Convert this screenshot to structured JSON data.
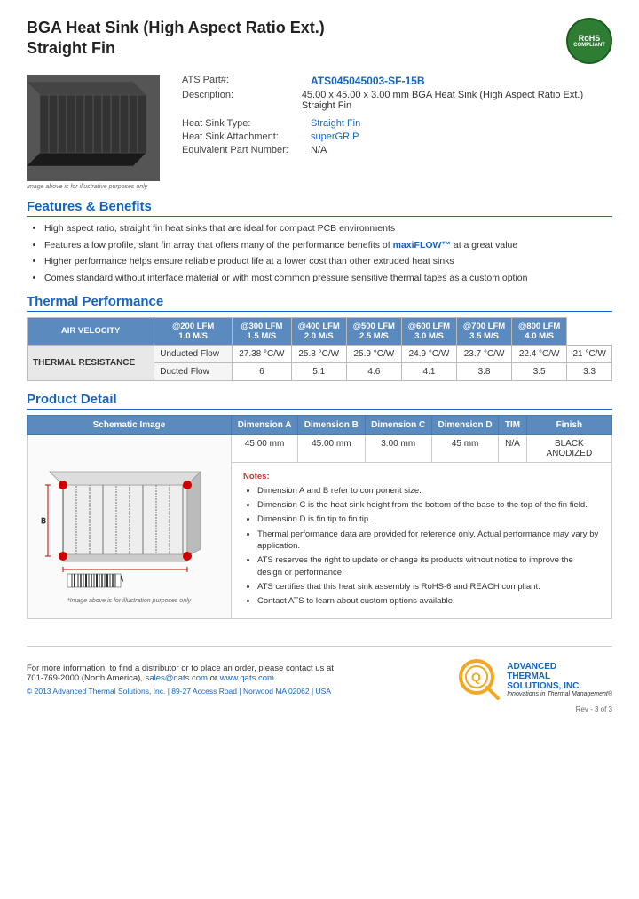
{
  "product": {
    "title_line1": "BGA Heat Sink (High Aspect Ratio Ext.)",
    "title_line2": "Straight Fin",
    "part_number": "ATS045045003-SF-15B",
    "description": "45.00 x 45.00 x 3.00 mm  BGA Heat Sink (High Aspect Ratio Ext.) Straight Fin",
    "heat_sink_type": "Straight Fin",
    "heat_sink_attachment": "superGRIP",
    "equivalent_part": "N/A"
  },
  "labels": {
    "part_number_label": "ATS Part#:",
    "description_label": "Description:",
    "heat_sink_type_label": "Heat Sink Type:",
    "attachment_label": "Heat Sink Attachment:",
    "equivalent_label": "Equivalent Part Number:",
    "image_caption": "Image above is for illustrative purposes only",
    "schematic_caption": "*Image above is for illustration purposes only",
    "rohs_line1": "RoHS",
    "rohs_line2": "COMPLIANT"
  },
  "sections": {
    "features_title": "Features & Benefits",
    "thermal_title": "Thermal Performance",
    "product_detail_title": "Product Detail"
  },
  "features": [
    "High aspect ratio, straight fin heat sinks that are ideal for compact PCB environments",
    "Features a low profile, slant fin array that offers many of the performance benefits of maxiFLOW™ at a great value",
    "Higher performance helps ensure reliable product life at a lower cost than other extruded heat sinks",
    "Comes standard without interface material or with most common pressure sensitive thermal tapes as a custom option"
  ],
  "thermal_table": {
    "headers": [
      "AIR VELOCITY",
      "@200 LFM\n1.0 M/S",
      "@300 LFM\n1.5 M/S",
      "@400 LFM\n2.0 M/S",
      "@500 LFM\n2.5 M/S",
      "@600 LFM\n3.0 M/S",
      "@700 LFM\n3.5 M/S",
      "@800 LFM\n4.0 M/S"
    ],
    "row_label": "THERMAL RESISTANCE",
    "rows": [
      {
        "label": "Unducted Flow",
        "values": [
          "27.38 °C/W",
          "25.8 °C/W",
          "25.9 °C/W",
          "24.9 °C/W",
          "23.7 °C/W",
          "22.4 °C/W",
          "21 °C/W"
        ]
      },
      {
        "label": "Ducted Flow",
        "values": [
          "6",
          "5.1",
          "4.6",
          "4.1",
          "3.8",
          "3.5",
          "3.3"
        ]
      }
    ]
  },
  "dimensions": {
    "headers": [
      "Schematic Image",
      "Dimension A",
      "Dimension B",
      "Dimension C",
      "Dimension D",
      "TIM",
      "Finish"
    ],
    "values": {
      "dim_a": "45.00 mm",
      "dim_b": "45.00 mm",
      "dim_c": "3.00 mm",
      "dim_d": "45 mm",
      "tim": "N/A",
      "finish": "BLACK ANODIZED"
    }
  },
  "notes": {
    "title": "Notes:",
    "items": [
      "Dimension A and B refer to component size.",
      "Dimension C is the heat sink height from the bottom of the base to the top of the fin field.",
      "Dimension D is fin tip to fin tip.",
      "Thermal performance data are provided for reference only. Actual performance may vary by application.",
      "ATS reserves the right to update or change its products without notice to improve the design or performance.",
      "ATS certifies that this heat sink assembly is RoHS-6 and REACH compliant.",
      "Contact ATS to learn about custom options available."
    ]
  },
  "footer": {
    "contact_text": "For more information, to find a distributor or to place an order, please contact us at\n701-769-2000 (North America),",
    "email": "sales@qats.com",
    "or_text": " or ",
    "website": "www.qats.com.",
    "copyright": "© 2013 Advanced Thermal Solutions, Inc. | 89-27 Access Road | Norwood MA  02062 | USA",
    "company_name": "ADVANCED\nTHERMAL\nSOLUTIONS, INC.",
    "tagline": "Innovations in Thermal Management®",
    "page_number": "Rev - 3 of 3"
  }
}
